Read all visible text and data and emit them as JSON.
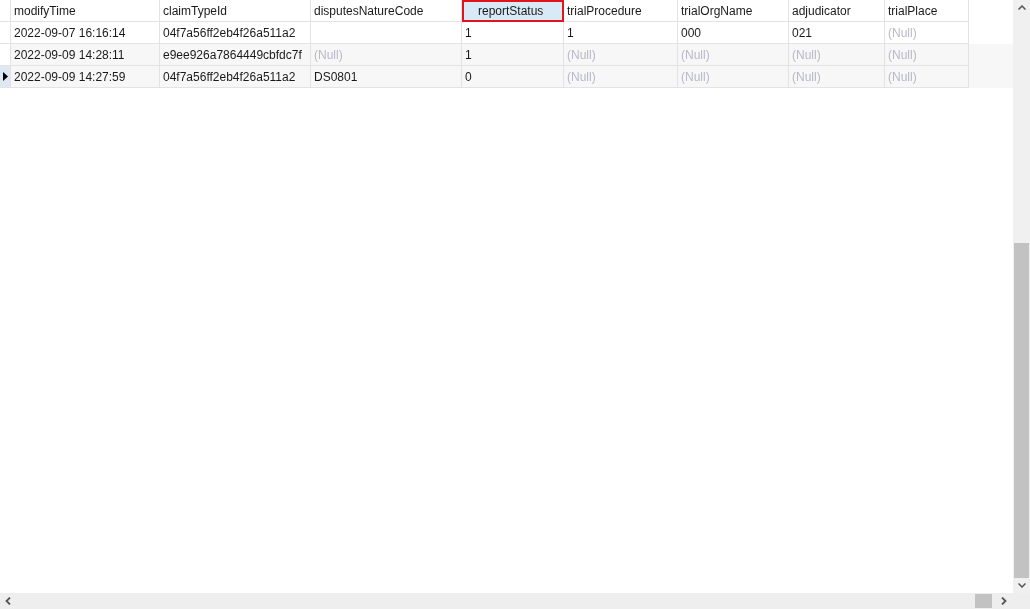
{
  "table": {
    "columns": [
      {
        "label": "modifyTime",
        "selected": false
      },
      {
        "label": "claimTypeId",
        "selected": false
      },
      {
        "label": "disputesNatureCode",
        "selected": false
      },
      {
        "label": "reportStatus",
        "selected": true
      },
      {
        "label": "trialProcedure",
        "selected": false
      },
      {
        "label": "trialOrgName",
        "selected": false
      },
      {
        "label": "adjudicator",
        "selected": false
      },
      {
        "label": "trialPlace",
        "selected": false
      }
    ],
    "rows": [
      {
        "current": false,
        "cells": [
          {
            "kind": "value",
            "text": "2022-09-07 16:16:14"
          },
          {
            "kind": "value",
            "text": "04f7a56ff2eb4f26a511a2"
          },
          {
            "kind": "empty"
          },
          {
            "kind": "value",
            "text": "1"
          },
          {
            "kind": "value",
            "text": "1"
          },
          {
            "kind": "value",
            "text": "000"
          },
          {
            "kind": "value",
            "text": "021"
          },
          {
            "kind": "null",
            "text": "(Null)"
          }
        ]
      },
      {
        "current": false,
        "cells": [
          {
            "kind": "value",
            "text": "2022-09-09 14:28:11"
          },
          {
            "kind": "value",
            "text": "e9ee926a7864449cbfdc7f"
          },
          {
            "kind": "null",
            "text": "(Null)"
          },
          {
            "kind": "value",
            "text": "1"
          },
          {
            "kind": "null",
            "text": "(Null)"
          },
          {
            "kind": "null",
            "text": "(Null)"
          },
          {
            "kind": "null",
            "text": "(Null)"
          },
          {
            "kind": "null",
            "text": "(Null)"
          }
        ]
      },
      {
        "current": true,
        "cells": [
          {
            "kind": "value",
            "text": "2022-09-09 14:27:59"
          },
          {
            "kind": "value",
            "text": "04f7a56ff2eb4f26a511a2"
          },
          {
            "kind": "value",
            "text": "DS0801"
          },
          {
            "kind": "value",
            "text": "0"
          },
          {
            "kind": "null",
            "text": "(Null)"
          },
          {
            "kind": "null",
            "text": "(Null)"
          },
          {
            "kind": "null",
            "text": "(Null)"
          },
          {
            "kind": "null",
            "text": "(Null)"
          }
        ]
      }
    ]
  }
}
